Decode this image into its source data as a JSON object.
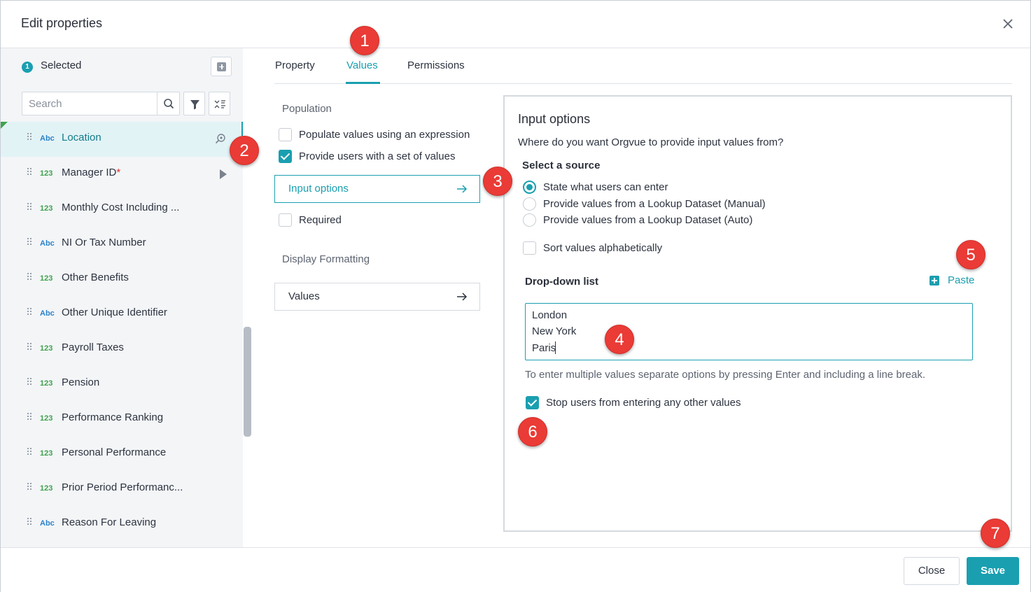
{
  "dialog": {
    "title": "Edit properties"
  },
  "sidebar": {
    "selected_count": "1",
    "selected_label": "Selected",
    "search_placeholder": "Search",
    "items": [
      {
        "type": "Abc",
        "label": "Location",
        "active": true
      },
      {
        "type": "123",
        "label": "Manager ID",
        "required_mark": "*"
      },
      {
        "type": "123",
        "label": "Monthly Cost Including ..."
      },
      {
        "type": "Abc",
        "label": "NI Or Tax Number"
      },
      {
        "type": "123",
        "label": "Other Benefits"
      },
      {
        "type": "Abc",
        "label": "Other Unique Identifier"
      },
      {
        "type": "123",
        "label": "Payroll Taxes"
      },
      {
        "type": "123",
        "label": "Pension"
      },
      {
        "type": "123",
        "label": "Performance Ranking"
      },
      {
        "type": "123",
        "label": "Personal Performance"
      },
      {
        "type": "123",
        "label": "Prior Period Performanc..."
      },
      {
        "type": "Abc",
        "label": "Reason For Leaving"
      }
    ]
  },
  "tabs": [
    {
      "label": "Property"
    },
    {
      "label": "Values",
      "active": true
    },
    {
      "label": "Permissions"
    }
  ],
  "population": {
    "heading": "Population",
    "options": [
      {
        "label": "Populate values using an expression",
        "checked": false
      },
      {
        "label": "Provide users with a set of values",
        "checked": true
      }
    ],
    "input_options_button": "Input options",
    "required_label": "Required",
    "required_checked": false,
    "display_heading": "Display Formatting",
    "values_button": "Values"
  },
  "input_options": {
    "title": "Input options",
    "question": "Where do you want Orgvue to provide input values from?",
    "source_heading": "Select a source",
    "sources": [
      {
        "label": "State what users can enter",
        "selected": true
      },
      {
        "label": "Provide values from a Lookup Dataset (Manual)",
        "selected": false
      },
      {
        "label": "Provide values from a Lookup Dataset (Auto)",
        "selected": false
      }
    ],
    "sort_label": "Sort values alphabetically",
    "sort_checked": false,
    "dropdown_label": "Drop-down list",
    "paste_label": "Paste",
    "dropdown_values": [
      "London",
      "New York",
      "Paris"
    ],
    "hint": "To enter multiple values separate options by pressing Enter and including a line break.",
    "stop_label": "Stop users from entering any other values",
    "stop_checked": true
  },
  "footer": {
    "close_label": "Close",
    "save_label": "Save"
  },
  "markers": [
    "1",
    "2",
    "3",
    "4",
    "5",
    "6",
    "7"
  ],
  "colors": {
    "accent": "#1a9fb0",
    "marker": "#ea3b36",
    "abc_type": "#2c82c9",
    "num_type": "#3fa34d"
  }
}
